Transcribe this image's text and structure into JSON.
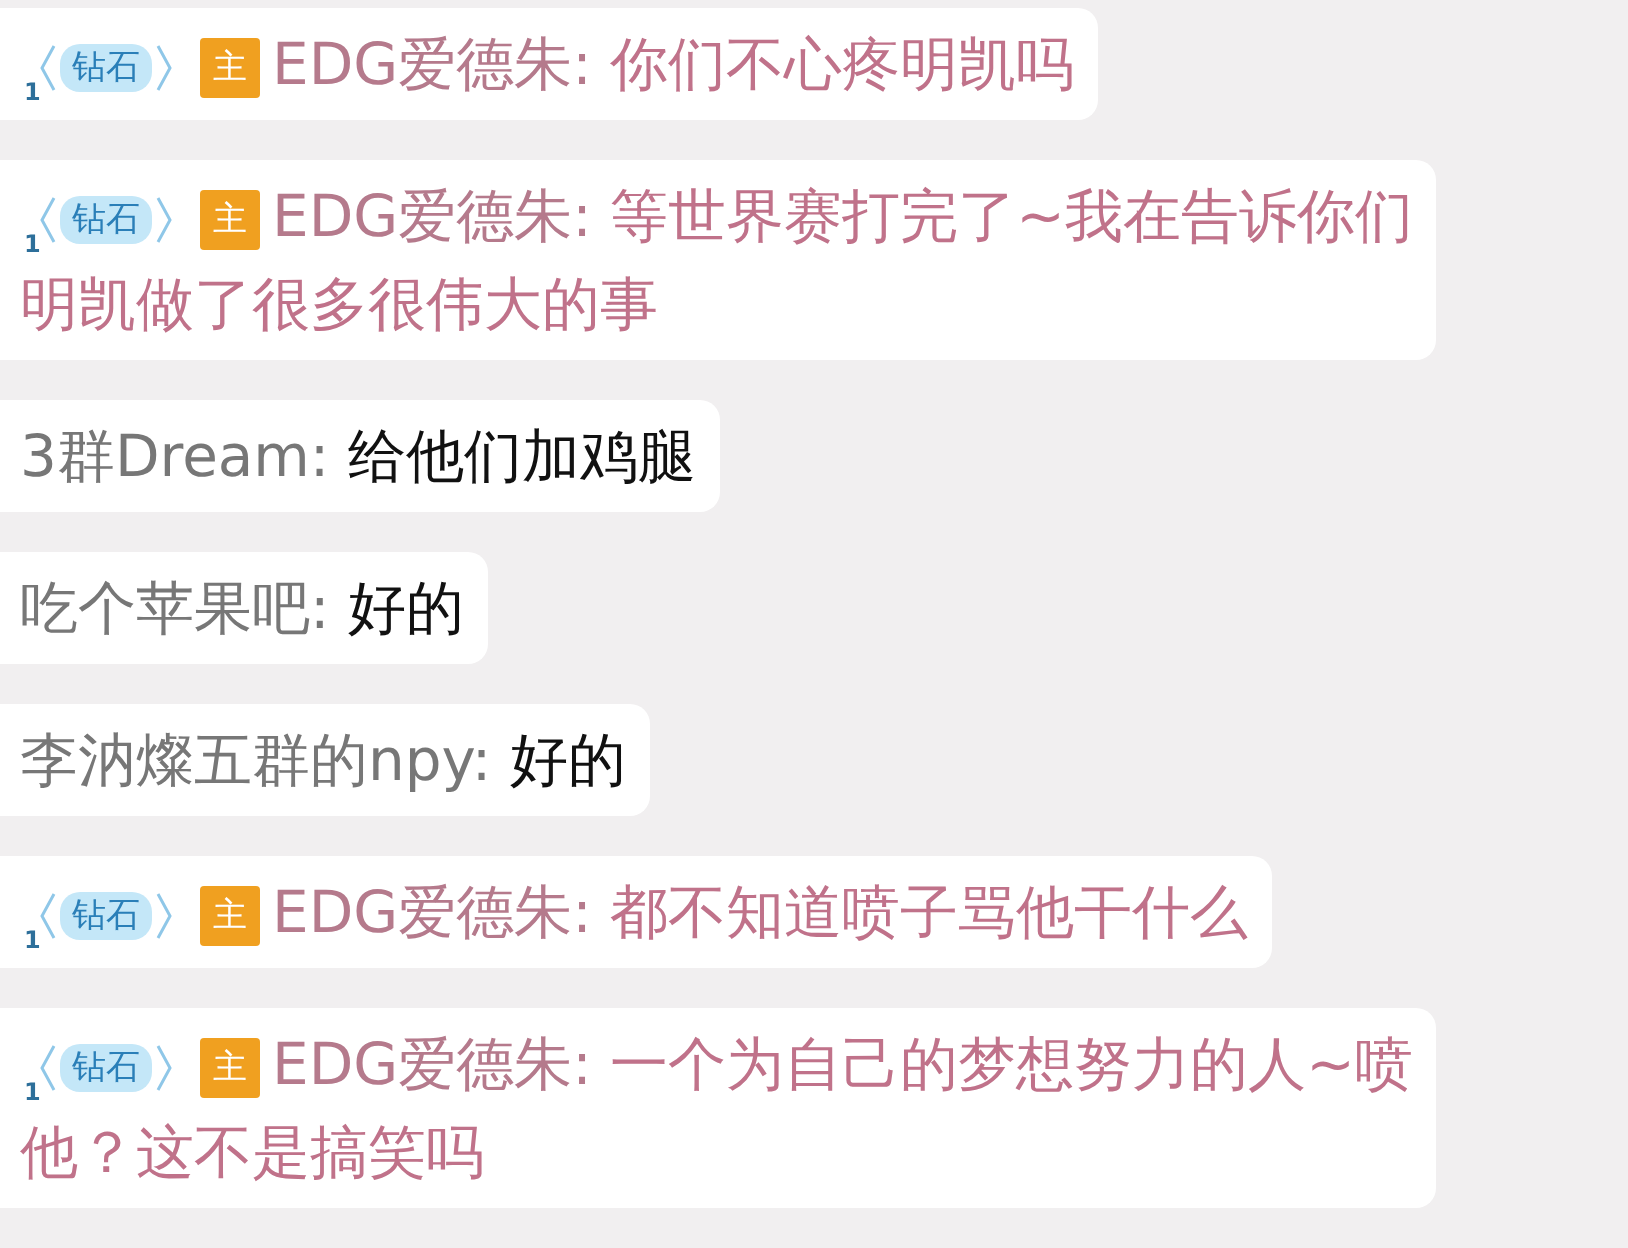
{
  "messages": [
    {
      "kind": "host",
      "badge": {
        "level": "1",
        "title": "钻石",
        "role": "主"
      },
      "user": "EDG爱德朱:",
      "lines": [
        "你们不心疼明凯吗"
      ]
    },
    {
      "kind": "host",
      "badge": {
        "level": "1",
        "title": "钻石",
        "role": "主"
      },
      "user": "EDG爱德朱:",
      "lines": [
        "等世界赛打完了~我在告诉你们",
        "明凯做了很多很伟大的事"
      ]
    },
    {
      "kind": "plain",
      "user": "3群Dream:",
      "lines": [
        "给他们加鸡腿"
      ]
    },
    {
      "kind": "plain",
      "user": "吃个苹果吧:",
      "lines": [
        "好的"
      ]
    },
    {
      "kind": "plain",
      "user": "李汭燦五群的npy:",
      "lines": [
        "好的"
      ]
    },
    {
      "kind": "host",
      "badge": {
        "level": "1",
        "title": "钻石",
        "role": "主"
      },
      "user": "EDG爱德朱:",
      "lines": [
        "都不知道喷子骂他干什么"
      ]
    },
    {
      "kind": "host",
      "badge": {
        "level": "1",
        "title": "钻石",
        "role": "主"
      },
      "user": "EDG爱德朱:",
      "lines": [
        "一个为自己的梦想努力的人~喷",
        "他？这不是搞笑吗"
      ]
    }
  ]
}
